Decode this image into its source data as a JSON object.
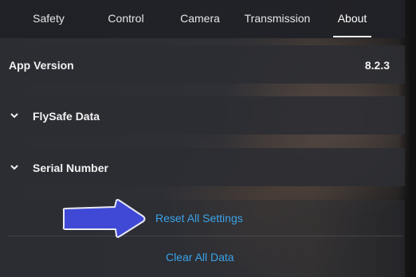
{
  "tabs": [
    {
      "label": "Safety"
    },
    {
      "label": "Control"
    },
    {
      "label": "Camera"
    },
    {
      "label": "Transmission"
    },
    {
      "label": "About",
      "active": true
    }
  ],
  "app_version": {
    "label": "App Version",
    "value": "8.2.3"
  },
  "sections": [
    {
      "label": "FlySafe Data",
      "icon": "chevron-down-icon"
    },
    {
      "label": "Serial Number",
      "icon": "chevron-down-icon"
    }
  ],
  "actions": {
    "reset_label": "Reset All Settings",
    "clear_label": "Clear All Data"
  },
  "colors": {
    "accent": "#3aa3e8",
    "annotation_arrow": "#3f49d6",
    "text": "#f2f2f2"
  }
}
